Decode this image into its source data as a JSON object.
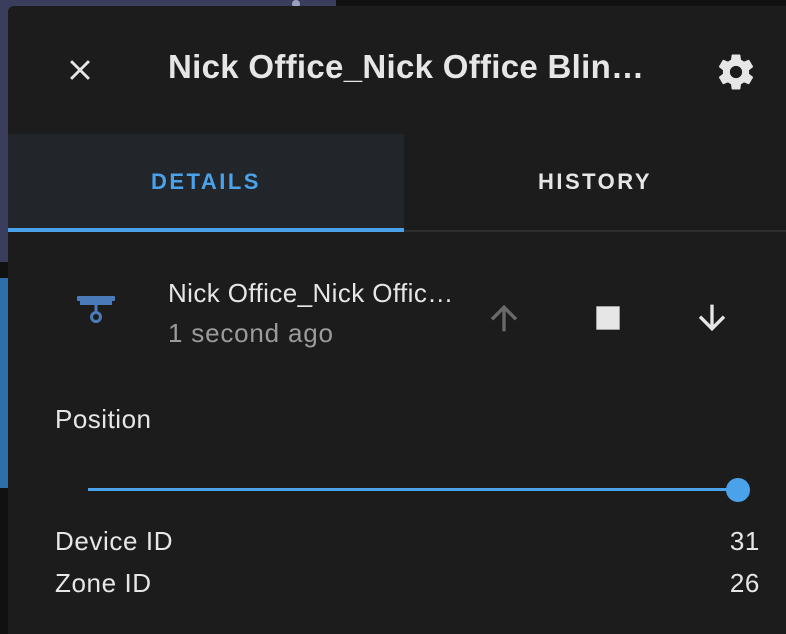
{
  "dialog": {
    "title": "Nick Office_Nick Office Blinds",
    "close_icon": "close-icon",
    "settings_icon": "gear-icon"
  },
  "tabs": [
    {
      "label": "DETAILS",
      "active": true
    },
    {
      "label": "HISTORY",
      "active": false
    }
  ],
  "entity": {
    "icon": "blinds-icon",
    "name": "Nick Office_Nick Office Blinds",
    "last_changed": "1 second ago",
    "controls": {
      "open_icon": "arrow-up-icon",
      "open_enabled": false,
      "stop_icon": "stop-icon",
      "close_icon": "arrow-down-icon"
    }
  },
  "position": {
    "label": "Position",
    "value_percent": 100
  },
  "attributes": [
    {
      "name": "Device ID",
      "value": "31"
    },
    {
      "name": "Zone ID",
      "value": "26"
    }
  ],
  "colors": {
    "accent": "#4aa2ea",
    "icon": "#4a7ab8",
    "background": "#1c1c1c",
    "text": "#e6e6e6",
    "secondary_text": "#9b9b9b"
  }
}
